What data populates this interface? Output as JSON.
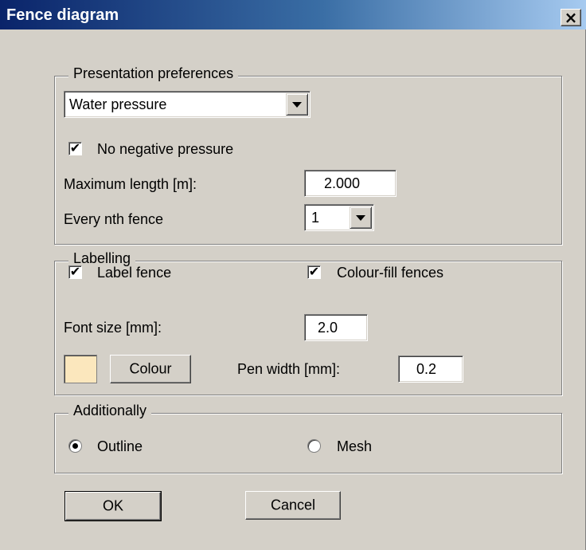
{
  "window": {
    "title": "Fence diagram",
    "close_glyph": "×"
  },
  "presentation": {
    "legend": "Presentation preferences",
    "mode_value": "Water pressure",
    "no_negative_label": "No negative pressure",
    "no_negative_checked": true,
    "max_length_label": "Maximum length [m]:",
    "max_length_value": "2.000",
    "every_nth_label": "Every nth fence",
    "every_nth_value": "1"
  },
  "labelling": {
    "legend": "Labelling",
    "label_fence_label": "Label fence",
    "label_fence_checked": true,
    "colour_fill_label": "Colour-fill fences",
    "colour_fill_checked": true,
    "font_size_label": "Font size [mm]:",
    "font_size_value": "2.0",
    "colour_button": "Colour",
    "swatch_color": "#fbe7bd",
    "pen_width_label": "Pen width [mm]:",
    "pen_width_value": "0.2"
  },
  "additionally": {
    "legend": "Additionally",
    "options": [
      {
        "label": "Outline",
        "selected": true
      },
      {
        "label": "Mesh",
        "selected": false
      }
    ]
  },
  "buttons": {
    "ok": "OK",
    "cancel": "Cancel"
  },
  "icons": {
    "check": "✔"
  }
}
